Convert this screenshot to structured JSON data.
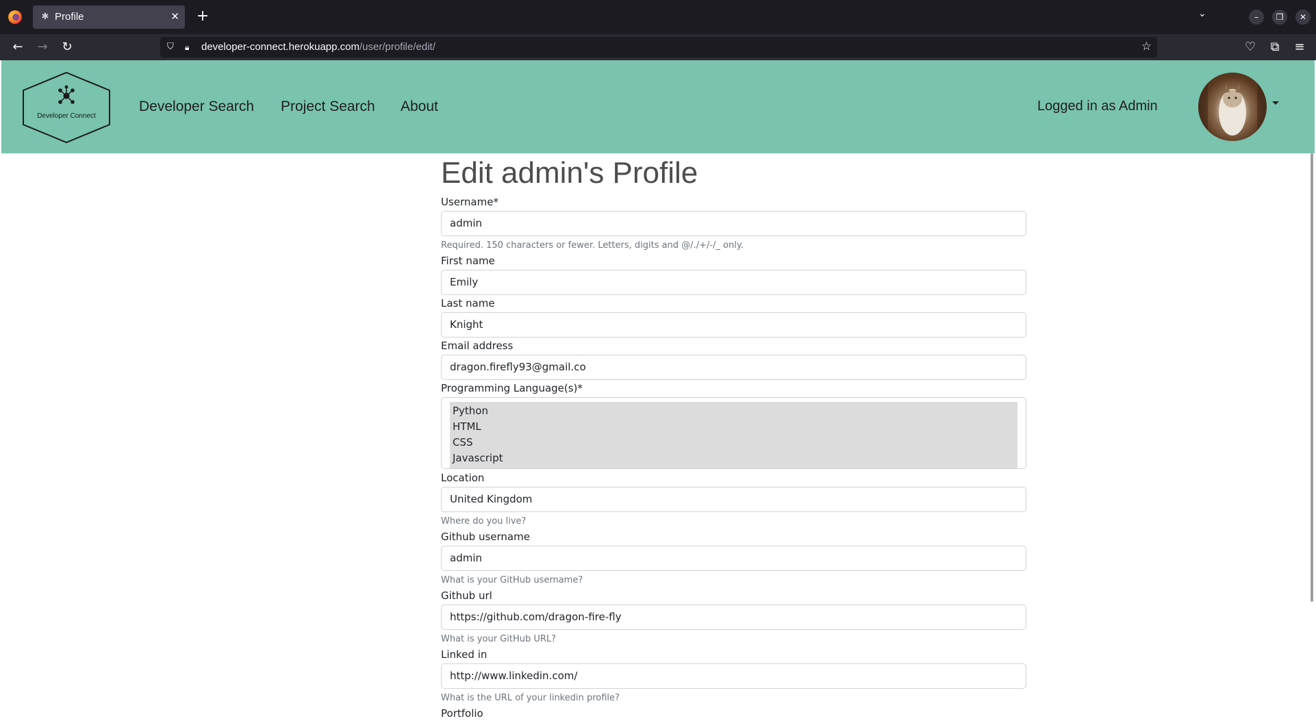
{
  "browser": {
    "tab_title": "Profile",
    "url_host": "developer-connect.herokuapp.com",
    "url_path": "/user/profile/edit/"
  },
  "site": {
    "brand_name": "Developer Connect",
    "nav": [
      "Developer Search",
      "Project Search",
      "About"
    ],
    "logged_in_text": "Logged in as Admin"
  },
  "colors": {
    "header_bg": "#7ac3ae",
    "title": "#4d4d4d",
    "help_text": "#6c757d"
  },
  "form": {
    "title": "Edit admin's Profile",
    "fields": {
      "username": {
        "label": "Username*",
        "value": "admin",
        "help": "Required. 150 characters or fewer. Letters, digits and @/./+/-/_ only."
      },
      "first_name": {
        "label": "First name",
        "value": "Emily"
      },
      "last_name": {
        "label": "Last name",
        "value": "Knight"
      },
      "email": {
        "label": "Email address",
        "value": "dragon.firefly93@gmail.co"
      },
      "languages": {
        "label": "Programming Language(s)*",
        "options": [
          "Python",
          "HTML",
          "CSS",
          "Javascript"
        ]
      },
      "location": {
        "label": "Location",
        "value": "United Kingdom",
        "help": "Where do you live?"
      },
      "github_username": {
        "label": "Github username",
        "value": "admin",
        "help": "What is your GitHub username?"
      },
      "github_url": {
        "label": "Github url",
        "value": "https://github.com/dragon-fire-fly",
        "help": "What is your GitHub URL?"
      },
      "linkedin": {
        "label": "Linked in",
        "value": "http://www.linkedin.com/",
        "help": "What is the URL of your linkedin profile?"
      },
      "portfolio": {
        "label": "Portfolio"
      }
    }
  }
}
